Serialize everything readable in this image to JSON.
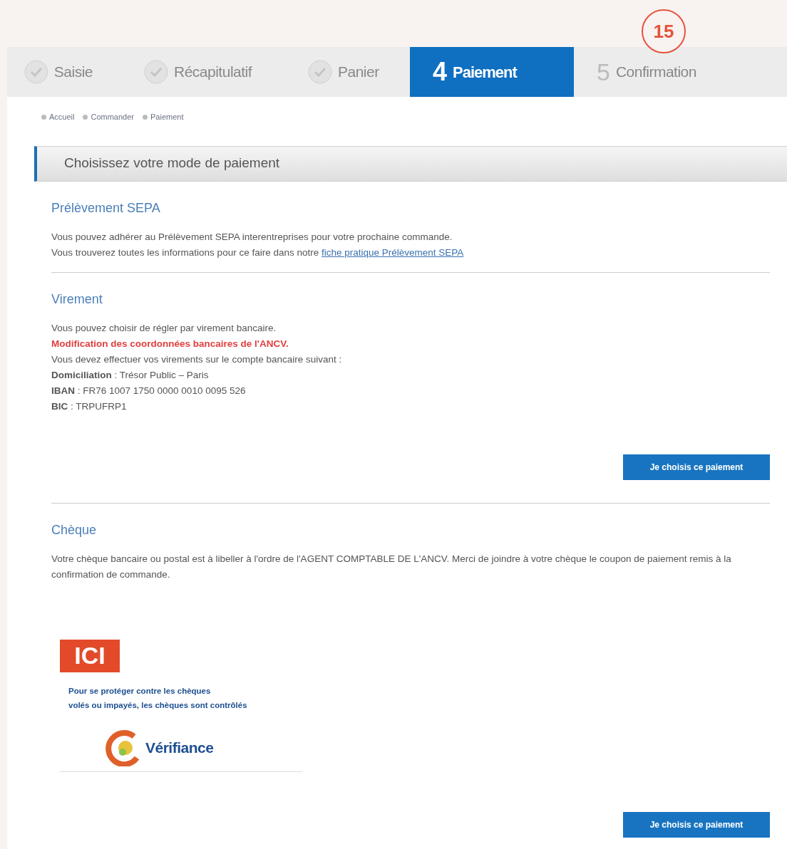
{
  "badge": "15",
  "steps": [
    {
      "label": "Saisie",
      "done": true,
      "selected": false
    },
    {
      "label": "Récapitulatif",
      "done": true,
      "selected": false
    },
    {
      "label": "Panier",
      "done": true,
      "selected": false
    },
    {
      "number": "4",
      "label": "Paiement",
      "done": false,
      "selected": true
    },
    {
      "number": "5",
      "label": "Confirmation",
      "done": false,
      "selected": false
    }
  ],
  "breadcrumb": [
    "Accueil",
    "Commander",
    "Paiement"
  ],
  "panel_title": "Choisissez votre mode de paiement",
  "sections": [
    {
      "title": "Prélèvement SEPA",
      "lines": [
        {
          "kind": "text",
          "text": "Vous pouvez adhérer au Prélèvement SEPA interentreprises pour votre prochaine commande."
        },
        {
          "kind": "text",
          "text": "Vous trouverez toutes les informations pour ce faire dans notre ",
          "link": "fiche pratique Prélèvement SEPA"
        }
      ]
    },
    {
      "title": "Virement",
      "lines": [
        {
          "kind": "text",
          "text": "Vous pouvez choisir de régler par virement bancaire."
        },
        {
          "kind": "alert",
          "text": "Modification des coordonnées bancaires de l'ANCV."
        },
        {
          "kind": "text",
          "text": "Vous devez effectuer vos virements sur le compte bancaire suivant :"
        },
        {
          "kind": "text",
          "text": "**Domiciliation** : Trésor Public – Paris"
        },
        {
          "kind": "text",
          "text": "**IBAN** : FR76 1007 1750 0000 0010 0095 526"
        },
        {
          "kind": "text",
          "text": "**BIC** : TRPUFRP1"
        }
      ],
      "button": "Je choisis ce paiement"
    },
    {
      "title": "Chèque",
      "lines": [
        {
          "kind": "text",
          "text": "Votre chèque bancaire ou postal est à libeller à l'ordre de l'AGENT COMPTABLE DE L'ANCV. Merci de joindre à votre chèque le coupon de paiement remis à la confirmation de commande."
        }
      ],
      "promo": {
        "tag": "ICI",
        "text": "Pour se protéger contre les chèques\nvolés ou impayés, les chèques sont contrôlés",
        "brand": "Vérifiance"
      },
      "button": "Je choisis ce paiement"
    }
  ]
}
